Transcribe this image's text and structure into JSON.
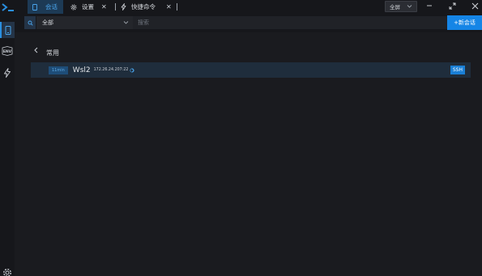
{
  "tabs": [
    {
      "label": "会话",
      "icon": "phone-icon",
      "active": true,
      "closable": false
    },
    {
      "label": "设置",
      "icon": "gear-icon",
      "active": false,
      "closable": true
    },
    {
      "label": "快捷命令",
      "icon": "lightning-icon",
      "active": false,
      "closable": true
    }
  ],
  "window": {
    "fullscreen_label": "全屏"
  },
  "toolbar": {
    "group_select_value": "全部",
    "search_placeholder": "搜索",
    "new_session_label": "+新会话"
  },
  "main": {
    "group_title": "常用",
    "sessions": [
      {
        "time_ago": "11min",
        "name": "Wsl2",
        "host": "172.26.24.207:22",
        "protocol": "SSH"
      }
    ]
  },
  "sidebar": {
    "env_label": "ENV"
  },
  "colors": {
    "accent": "#1585e6",
    "active_tab_bg": "#1d3a55",
    "background": "#1a1b1f",
    "bar_background": "#16171b"
  }
}
